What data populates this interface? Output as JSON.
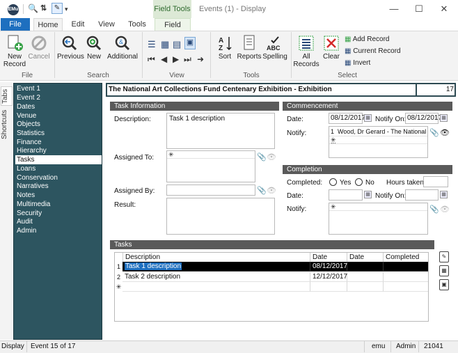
{
  "window": {
    "app_icon_text": "EMu",
    "title": "Events (1) - Display",
    "field_tools_tab": "Field Tools"
  },
  "ribbon_tabs": [
    "File",
    "Home",
    "Edit",
    "View",
    "Tools",
    "Field"
  ],
  "ribbon": {
    "file_group": {
      "label": "File",
      "new_record": "New Record",
      "cancel": "Cancel"
    },
    "search_group": {
      "label": "Search",
      "previous": "Previous",
      "new": "New",
      "additional": "Additional"
    },
    "view_group": {
      "label": "View"
    },
    "tools_group": {
      "label": "Tools",
      "sort": "Sort",
      "reports": "Reports",
      "spelling": "Spelling"
    },
    "select_group": {
      "label": "Select",
      "all_records": "All Records",
      "clear": "Clear",
      "add_record": "Add Record",
      "current_record": "Current Record",
      "invert": "Invert"
    }
  },
  "side_tabs": {
    "tabs": "Tabs",
    "shortcuts": "Shortcuts"
  },
  "nav_items": [
    "Event 1",
    "Event 2",
    "Dates",
    "Venue",
    "Objects",
    "Statistics",
    "Finance",
    "Hierarchy",
    "Tasks",
    "Loans",
    "Conservation",
    "Narratives",
    "Notes",
    "Multimedia",
    "Security",
    "Audit",
    "Admin"
  ],
  "nav_active": "Tasks",
  "header": {
    "title": "The National Art Collections Fund Centenary Exhibition - Exhibition",
    "record_number": "17"
  },
  "task_info": {
    "heading": "Task Information",
    "description_label": "Description:",
    "description_value": "Task 1 description",
    "assigned_to_label": "Assigned To:",
    "assigned_by_label": "Assigned By:",
    "result_label": "Result:",
    "new_row_glyph": "✳"
  },
  "commencement": {
    "heading": "Commencement",
    "date_label": "Date:",
    "date_value": "08/12/2017",
    "notify_on_label": "Notify On:",
    "notify_on_value": "08/12/2017",
    "notify_label": "Notify:",
    "notify_row_num": "1",
    "notify_value": "Wood, Dr Gerard - The National ..."
  },
  "completion": {
    "heading": "Completion",
    "completed_label": "Completed:",
    "yes_label": "Yes",
    "no_label": "No",
    "hours_label": "Hours taken:",
    "date_label": "Date:",
    "notify_on_label": "Notify On:",
    "notify_label": "Notify:"
  },
  "tasks": {
    "heading": "Tasks",
    "columns": [
      "Description",
      "Date",
      "Date",
      "Completed"
    ],
    "rows": [
      {
        "num": "1",
        "description": "Task 1 description",
        "date": "08/12/2017",
        "date2": "",
        "completed": ""
      },
      {
        "num": "2",
        "description": "Task 2 description",
        "date": "12/12/2017",
        "date2": "",
        "completed": ""
      }
    ]
  },
  "status_bar": {
    "mode": "Display",
    "position": "Event 15 of 17",
    "user": "emu",
    "role": "Admin",
    "id": "21041"
  }
}
